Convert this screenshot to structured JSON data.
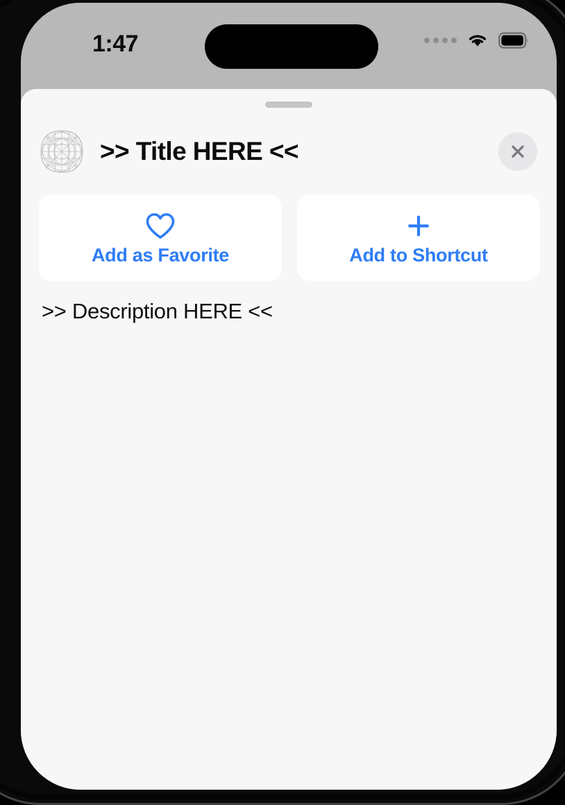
{
  "status_bar": {
    "time": "1:47",
    "cellular_icon": "cellular-dots-icon",
    "wifi_icon": "wifi-icon",
    "battery_icon": "battery-full-icon",
    "dynamic_island": "dynamic-island"
  },
  "sheet": {
    "grabber": "sheet-grabber",
    "app_icon": "app-icon-grid-placeholder",
    "title": ">> Title HERE <<",
    "close_label": "close-icon",
    "description": ">> Description HERE <<",
    "actions": [
      {
        "icon": "heart-outline-icon",
        "label": "Add as Favorite"
      },
      {
        "icon": "plus-icon",
        "label": "Add to Shortcut"
      }
    ]
  },
  "colors": {
    "accent_blue": "#2f7df6",
    "sheet_background": "#f7f7f7",
    "card_background": "#ffffff",
    "backdrop_gray": "#b4b4b4",
    "close_button_background": "#e7e7e9",
    "close_icon": "#7a7a7e",
    "text_primary": "#0d0d0d"
  }
}
